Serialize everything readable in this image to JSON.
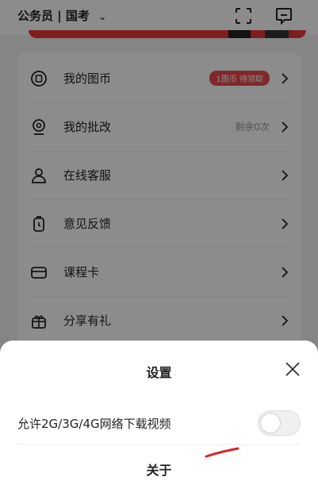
{
  "header": {
    "exam_selector": "公务员 | 国考",
    "chevron_icon": "chevron-down-icon",
    "scan_icon": "scan-icon",
    "message_icon": "message-icon"
  },
  "menu": {
    "items": [
      {
        "label": "我的图币",
        "badge": "1图币 待领取",
        "icon": "coin-icon"
      },
      {
        "label": "我的批改",
        "extra": "剩余0次",
        "icon": "camera-icon"
      },
      {
        "label": "在线客服",
        "icon": "user-service-icon"
      },
      {
        "label": "意见反馈",
        "icon": "feedback-icon"
      },
      {
        "label": "课程卡",
        "icon": "card-icon"
      },
      {
        "label": "分享有礼",
        "icon": "gift-icon"
      }
    ]
  },
  "settings_sheet": {
    "title": "设置",
    "close_icon": "close-icon",
    "mobile_download_label": "允许2G/3G/4G网络下载视频",
    "mobile_download_enabled": false,
    "about_label": "关于"
  },
  "colors": {
    "accent": "#e8353a",
    "badge_bg": "#e84a4f",
    "overlay": "rgba(0,0,0,0.45)"
  }
}
